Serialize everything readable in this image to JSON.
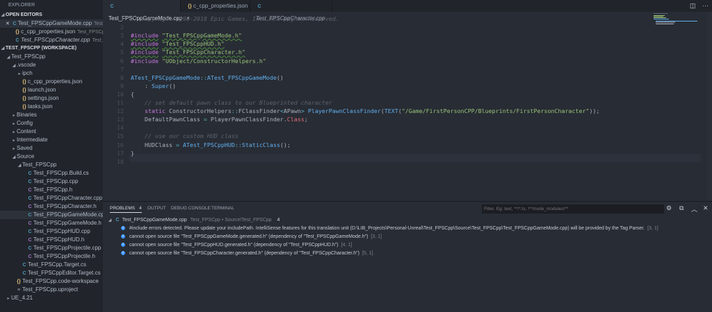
{
  "sidebar": {
    "title": "EXPLORER",
    "open_editors_label": "OPEN EDITORS",
    "open_editors": [
      {
        "name": "Test_FPSCppGameMode.cpp",
        "desc": "Test_F...",
        "icon": "cpp"
      },
      {
        "name": "c_cpp_properties.json",
        "desc": "Test_FPSCpp •...",
        "icon": "json"
      },
      {
        "name": "Test_FPSCppCharacter.cpp",
        "desc": "Test_FPS...",
        "icon": "cpp"
      }
    ],
    "workspace_label": "TEST_FPSCPP (WORKSPACE)",
    "tree": [
      {
        "name": "Test_FPSCpp",
        "depth": 0,
        "twisty": "open"
      },
      {
        "name": ".vscode",
        "depth": 1,
        "twisty": "open"
      },
      {
        "name": "ipch",
        "depth": 2,
        "twisty": "closed"
      },
      {
        "name": "c_cpp_properties.json",
        "depth": 2,
        "icon": "json"
      },
      {
        "name": "launch.json",
        "depth": 2,
        "icon": "json"
      },
      {
        "name": "settings.json",
        "depth": 2,
        "icon": "json"
      },
      {
        "name": "tasks.json",
        "depth": 2,
        "icon": "json"
      },
      {
        "name": "Binaries",
        "depth": 1,
        "twisty": "closed"
      },
      {
        "name": "Config",
        "depth": 1,
        "twisty": "closed"
      },
      {
        "name": "Content",
        "depth": 1,
        "twisty": "closed"
      },
      {
        "name": "Intermediate",
        "depth": 1,
        "twisty": "closed"
      },
      {
        "name": "Saved",
        "depth": 1,
        "twisty": "closed"
      },
      {
        "name": "Source",
        "depth": 1,
        "twisty": "open"
      },
      {
        "name": "Test_FPSCpp",
        "depth": 2,
        "twisty": "open"
      },
      {
        "name": "Test_FPSCpp.Build.cs",
        "depth": 3,
        "icon": "cs"
      },
      {
        "name": "Test_FPSCpp.cpp",
        "depth": 3,
        "icon": "cpp"
      },
      {
        "name": "Test_FPSCpp.h",
        "depth": 3,
        "icon": "h"
      },
      {
        "name": "Test_FPSCppCharacter.cpp",
        "depth": 3,
        "icon": "cpp"
      },
      {
        "name": "Test_FPSCppCharacter.h",
        "depth": 3,
        "icon": "h"
      },
      {
        "name": "Test_FPSCppGameMode.cpp",
        "depth": 3,
        "icon": "cpp",
        "selected": true
      },
      {
        "name": "Test_FPSCppGameMode.h",
        "depth": 3,
        "icon": "h"
      },
      {
        "name": "Test_FPSCppHUD.cpp",
        "depth": 3,
        "icon": "cpp"
      },
      {
        "name": "Test_FPSCppHUD.h",
        "depth": 3,
        "icon": "h"
      },
      {
        "name": "Test_FPSCppProjectile.cpp",
        "depth": 3,
        "icon": "cpp"
      },
      {
        "name": "Test_FPSCppProjectile.h",
        "depth": 3,
        "icon": "h"
      },
      {
        "name": "Test_FPSCpp.Target.cs",
        "depth": 2,
        "icon": "cs"
      },
      {
        "name": "Test_FPSCppEditor.Target.cs",
        "depth": 2,
        "icon": "cs"
      },
      {
        "name": "Test_FPSCpp.code-workspace",
        "depth": 1,
        "icon": "json"
      },
      {
        "name": "Test_FPSCpp.uproject",
        "depth": 1,
        "icon": "up"
      },
      {
        "name": "UE_4.21",
        "depth": 0,
        "twisty": "closed"
      }
    ]
  },
  "tabs": [
    {
      "label": "Test_FPSCppGameMode.cpp",
      "icon": "cpp",
      "active": true,
      "close": "×"
    },
    {
      "label": "c_cpp_properties.json",
      "icon": "json"
    },
    {
      "label": "Test_FPSCppCharacter.cpp",
      "icon": "cpp",
      "italic": true
    }
  ],
  "icons": {
    "json": "{}",
    "cpp": "C",
    "h": "C",
    "cs": "C",
    "up": "≡"
  },
  "code": [
    [
      [
        "// Copyright 1998-2018 Epic Games, Inc. All Rights Reserved.",
        "com"
      ]
    ],
    [],
    [
      [
        "#include",
        "pp",
        1
      ],
      [
        " ",
        "pl"
      ],
      [
        "\"Test_FPSCppGameMode.h\"",
        "str",
        1
      ]
    ],
    [
      [
        "#include",
        "pp",
        1
      ],
      [
        " ",
        "pl"
      ],
      [
        "\"Test_FPSCppHUD.h\"",
        "str",
        1
      ]
    ],
    [
      [
        "#include",
        "pp",
        1
      ],
      [
        " ",
        "pl"
      ],
      [
        "\"Test_FPSCppCharacter.h\"",
        "str",
        1
      ]
    ],
    [
      [
        "#include",
        "pp"
      ],
      [
        " ",
        "pl"
      ],
      [
        "\"UObject/ConstructorHelpers.h\"",
        "str"
      ]
    ],
    [],
    [
      [
        "ATest_FPSCppGameMode",
        "fn"
      ],
      [
        "::",
        "op"
      ],
      [
        "ATest_FPSCppGameMode",
        "fn"
      ],
      [
        "()",
        "pl"
      ]
    ],
    [
      [
        "    : ",
        "pl"
      ],
      [
        "Super",
        "fn"
      ],
      [
        "()",
        "pl"
      ]
    ],
    [
      [
        "{",
        "pl"
      ]
    ],
    [
      [
        "    // set default pawn class to our Blueprinted character",
        "com"
      ]
    ],
    [
      [
        "    ",
        "pl"
      ],
      [
        "static",
        "kw"
      ],
      [
        " ConstructorHelpers",
        "pl"
      ],
      [
        "::",
        "op"
      ],
      [
        "FClassFinder",
        "pl"
      ],
      [
        "<",
        "op"
      ],
      [
        "APawn",
        "pl"
      ],
      [
        ">",
        "op"
      ],
      [
        " ",
        "pl"
      ],
      [
        "PlayerPawnClassFinder",
        "fn"
      ],
      [
        "(",
        "pl"
      ],
      [
        "TEXT",
        "fn"
      ],
      [
        "(",
        "pl"
      ],
      [
        "\"/Game/FirstPersonCPP/Blueprints/FirstPersonCharacter\"",
        "str"
      ],
      [
        "));",
        "pl"
      ]
    ],
    [
      [
        "    DefaultPawnClass ",
        "pl"
      ],
      [
        "=",
        "op"
      ],
      [
        " PlayerPawnClassFinder.",
        "pl"
      ],
      [
        "Class",
        "prop"
      ],
      [
        ";",
        "pl"
      ]
    ],
    [],
    [
      [
        "    // use our custom HUD class",
        "com"
      ]
    ],
    [
      [
        "    HUDClass ",
        "pl"
      ],
      [
        "=",
        "op"
      ],
      [
        " ",
        "pl"
      ],
      [
        "ATest_FPSCppHUD",
        "fn"
      ],
      [
        "::",
        "op"
      ],
      [
        "StaticClass",
        "fn"
      ],
      [
        "();",
        "pl"
      ]
    ],
    [
      [
        "}",
        "pl"
      ]
    ],
    []
  ],
  "panel": {
    "tabs": [
      {
        "label": "PROBLEMS",
        "badge": "4",
        "active": true
      },
      {
        "label": "OUTPUT"
      },
      {
        "label": "DEBUG CONSOLE"
      },
      {
        "label": "TERMINAL"
      }
    ],
    "filter_placeholder": "Filter. Eg: text, **/*.ts, !**/node_modules/**",
    "file": {
      "name": "Test_FPSCppGameMode.cpp",
      "path": "Test_FPSCpp • Source\\Test_FPSCpp",
      "count": "4"
    },
    "problems": [
      {
        "msg": "#include errors detected. Please update your includePath. IntelliSense features for this translation unit (D:\\LIB_Projects\\Personal-Unreal\\Test_FPSCpp\\Source\\Test_FPSCpp\\Test_FPSCppGameMode.cpp) will be provided by the Tag Parser.",
        "loc": "[3, 1]"
      },
      {
        "msg": "cannot open source file \"Test_FPSCppGameMode.generated.h\" (dependency of \"Test_FPSCppGameMode.h\")",
        "loc": "[3, 1]"
      },
      {
        "msg": "cannot open source file \"Test_FPSCppHUD.generated.h\" (dependency of \"Test_FPSCppHUD.h\")",
        "loc": "[4, 1]"
      },
      {
        "msg": "cannot open source file \"Test_FPSCppCharacter.generated.h\" (dependency of \"Test_FPSCppCharacter.h\")",
        "loc": "[5, 1]"
      }
    ]
  },
  "colors": {
    "sidebar": "#21252b",
    "editor": "#282c34",
    "info": "#3794ff"
  }
}
